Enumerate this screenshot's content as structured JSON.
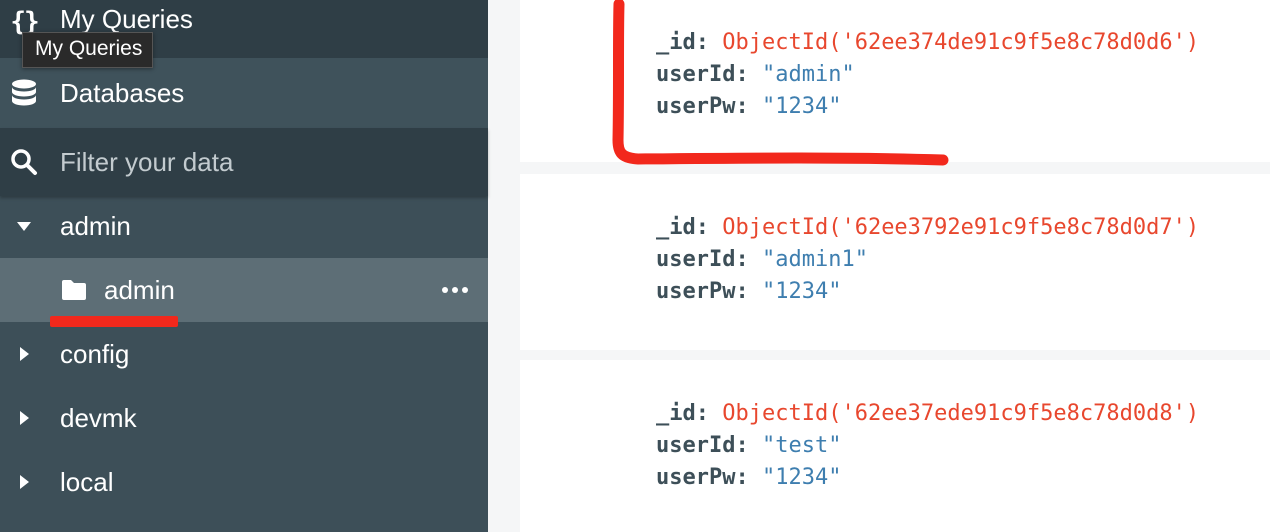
{
  "sidebar": {
    "my_queries_label": "My Queries",
    "tooltip_text": "My Queries",
    "databases_label": "Databases",
    "filter_placeholder": "Filter your data",
    "databases": [
      {
        "name": "admin",
        "expanded": true
      },
      {
        "name": "config",
        "expanded": false
      },
      {
        "name": "devmk",
        "expanded": false
      },
      {
        "name": "local",
        "expanded": false
      }
    ],
    "collections": [
      {
        "name": "admin",
        "selected": true
      }
    ]
  },
  "documents": [
    {
      "id_key": "_id",
      "id_value": "ObjectId('62ee374de91c9f5e8c78d0d6')",
      "userId_key": "userId",
      "userId_value": "\"admin\"",
      "userPw_key": "userPw",
      "userPw_value": "\"1234\""
    },
    {
      "id_key": "_id",
      "id_value": "ObjectId('62ee3792e91c9f5e8c78d0d7')",
      "userId_key": "userId",
      "userId_value": "\"admin1\"",
      "userPw_key": "userPw",
      "userPw_value": "\"1234\""
    },
    {
      "id_key": "_id",
      "id_value": "ObjectId('62ee37ede91c9f5e8c78d0d8')",
      "userId_key": "userId",
      "userId_value": "\"test\"",
      "userPw_key": "userPw",
      "userPw_value": "\"1234\""
    }
  ],
  "colors": {
    "sidebar_bg": "#3d4f58",
    "sidebar_dark": "#2f3e46",
    "selected_bg": "#5d6e76",
    "objectid": "#e8472e",
    "string_value": "#3e7eaf",
    "key": "#3d4f58",
    "annotation_red": "#f2281c"
  },
  "icons": {
    "my_queries": "braces-icon",
    "databases": "database-icon",
    "filter": "search-icon",
    "expanded": "caret-down-icon",
    "collapsed": "caret-right-icon",
    "collection": "folder-icon",
    "more": "more-options-icon"
  }
}
